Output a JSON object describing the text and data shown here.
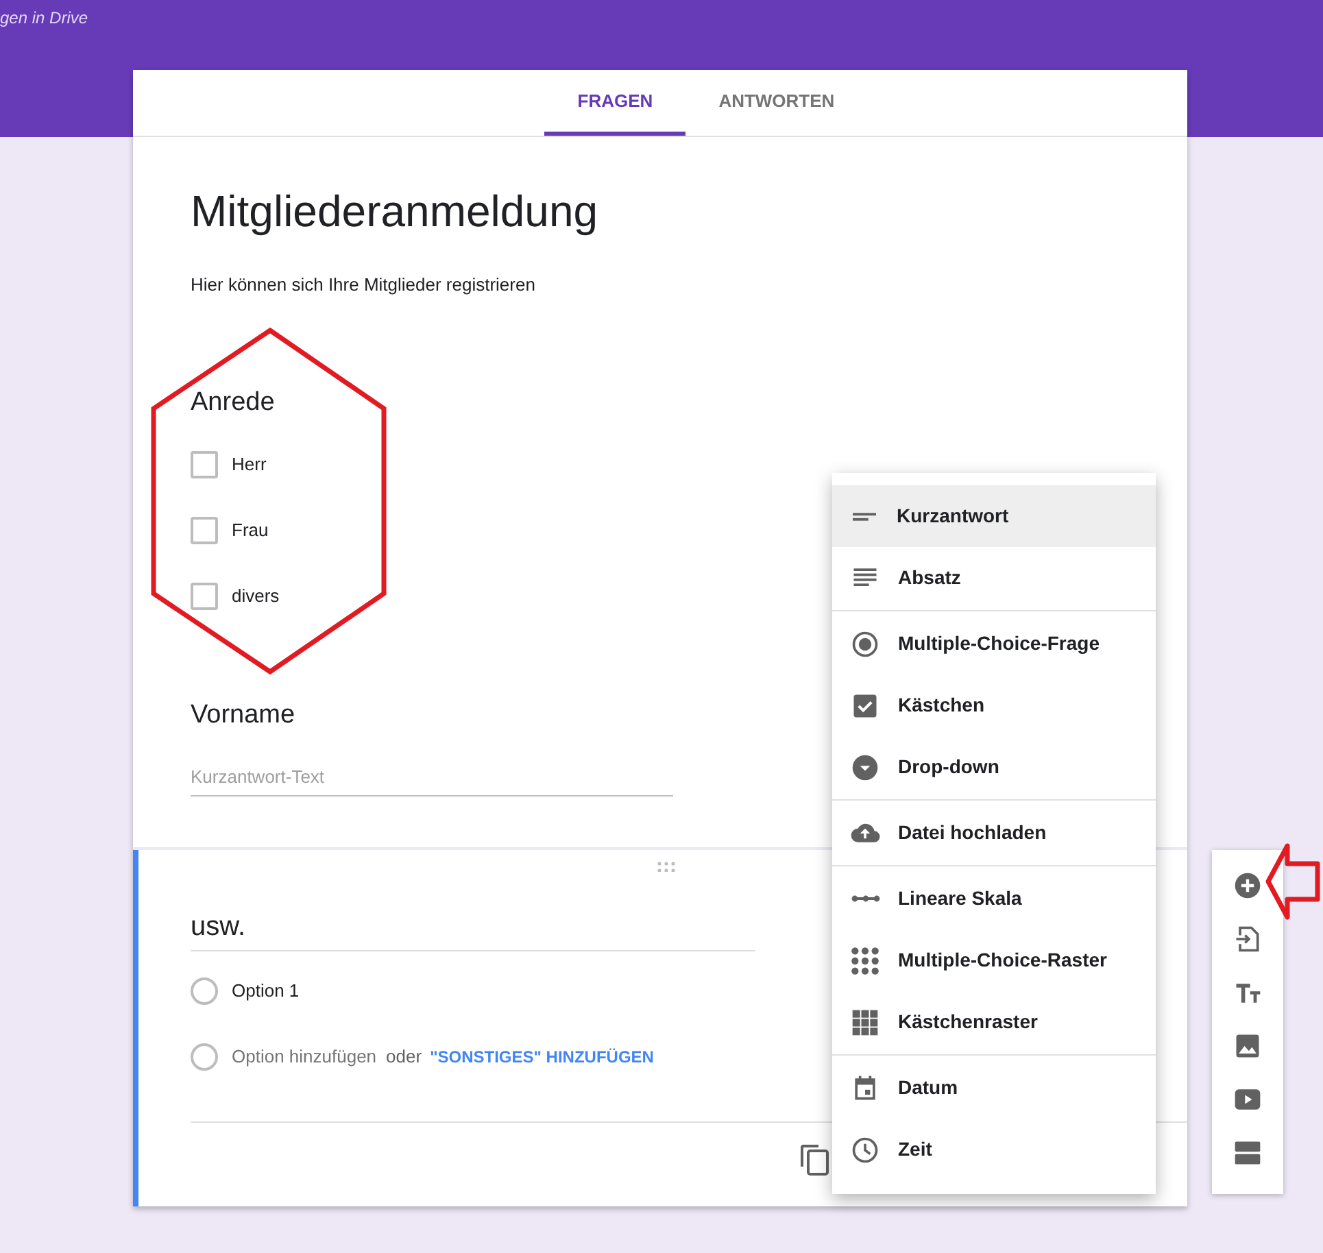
{
  "header": {
    "caption": "gen in Drive"
  },
  "tabs": [
    {
      "label": "FRAGEN",
      "selected": true
    },
    {
      "label": "ANTWORTEN",
      "selected": false
    }
  ],
  "form": {
    "title": "Mitgliederanmeldung",
    "description": "Hier können sich Ihre Mitglieder registrieren",
    "questions": [
      {
        "kind": "checkbox",
        "title": "Anrede",
        "options": [
          {
            "label": "Herr",
            "checked": false
          },
          {
            "label": "Frau",
            "checked": false
          },
          {
            "label": "divers",
            "checked": false
          }
        ]
      },
      {
        "kind": "short",
        "title": "Vorname",
        "placeholder": "Kurzantwort-Text"
      }
    ]
  },
  "editing_question": {
    "title": "usw.",
    "options": [
      "Option 1"
    ],
    "add_option": "Option hinzufügen",
    "or": "oder",
    "add_other": "\"SONSTIGES\" HINZUFÜGEN"
  },
  "type_menu": [
    [
      {
        "kind": "short",
        "label": "Kurzantwort",
        "selected": true
      },
      {
        "kind": "paragraph",
        "label": "Absatz",
        "selected": false
      }
    ],
    [
      {
        "kind": "radio",
        "label": "Multiple-Choice-Frage",
        "selected": false
      },
      {
        "kind": "checkbox",
        "label": "Kästchen",
        "selected": false
      },
      {
        "kind": "dropdown",
        "label": "Drop-down",
        "selected": false
      }
    ],
    [
      {
        "kind": "upload",
        "label": "Datei hochladen",
        "selected": false
      }
    ],
    [
      {
        "kind": "scale",
        "label": "Lineare Skala",
        "selected": false
      },
      {
        "kind": "dotgrid",
        "label": "Multiple-Choice-Raster",
        "selected": false
      },
      {
        "kind": "grid",
        "label": "Kästchenraster",
        "selected": false
      }
    ],
    [
      {
        "kind": "date",
        "label": "Datum",
        "selected": false
      },
      {
        "kind": "time",
        "label": "Zeit",
        "selected": false
      }
    ]
  ],
  "side_toolbar": [
    {
      "kind": "add"
    },
    {
      "kind": "import"
    },
    {
      "kind": "title"
    },
    {
      "kind": "image"
    },
    {
      "kind": "video"
    },
    {
      "kind": "section"
    }
  ]
}
